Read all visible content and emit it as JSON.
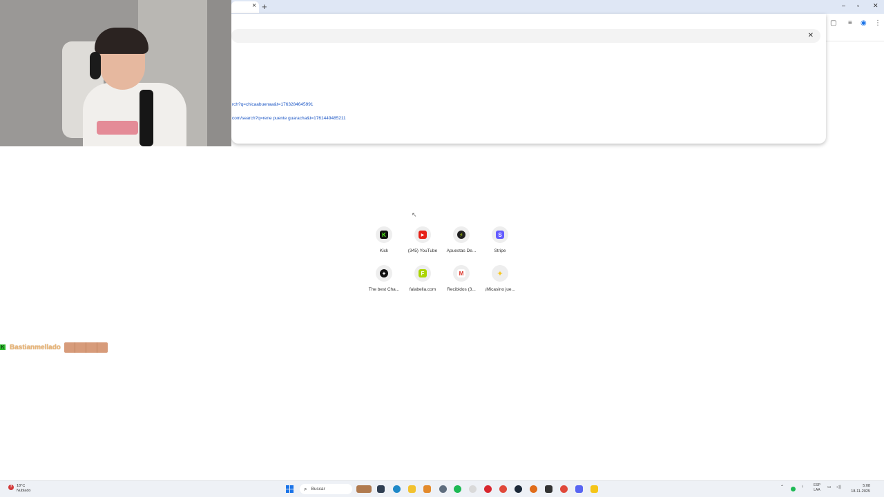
{
  "browser": {
    "tab_close": "×",
    "new_tab": "+",
    "window_controls": {
      "minimize": "–",
      "maximize": "▫",
      "close": "✕"
    }
  },
  "omnibox": {
    "close": "✕",
    "suggestions": [
      "rch?q=chicaabuenaa&t=1763284645991",
      "com/search?q=rene puente guaracha&t=1761449485211"
    ]
  },
  "shortcuts": [
    {
      "label": "Kick",
      "icon": "kick-icon",
      "color": "#53fc18",
      "glyph": "K"
    },
    {
      "label": "(345) YouTube",
      "icon": "youtube-icon",
      "color": "#e62117",
      "glyph": "▶"
    },
    {
      "label": "Apuestas De...",
      "icon": "bolt-icon",
      "color": "#2e7d32",
      "glyph": "⚡"
    },
    {
      "label": "Stripe",
      "icon": "stripe-icon",
      "color": "#635bff",
      "glyph": "S"
    },
    {
      "label": "The best Cha...",
      "icon": "chatgpt-icon",
      "color": "#111111",
      "glyph": "✦"
    },
    {
      "label": "falabella.com",
      "icon": "falabella-icon",
      "color": "#aad500",
      "glyph": "F"
    },
    {
      "label": "Recibidos (3...",
      "icon": "gmail-icon",
      "color": "#ffffff",
      "glyph": "M"
    },
    {
      "label": "¡Micasino jue...",
      "icon": "star-icon",
      "color": "#f7c61a",
      "glyph": "✦"
    }
  ],
  "chat": {
    "badge": "K",
    "username": "Bastianmellado"
  },
  "taskbar": {
    "weather": {
      "badge": "3",
      "temp": "18°C",
      "condition": "Nublado"
    },
    "search_label": "Buscar",
    "tray": {
      "lang_top": "ESP",
      "lang_bottom": "LAA"
    },
    "clock": {
      "time": "5:08",
      "date": "18-11-2025"
    }
  }
}
